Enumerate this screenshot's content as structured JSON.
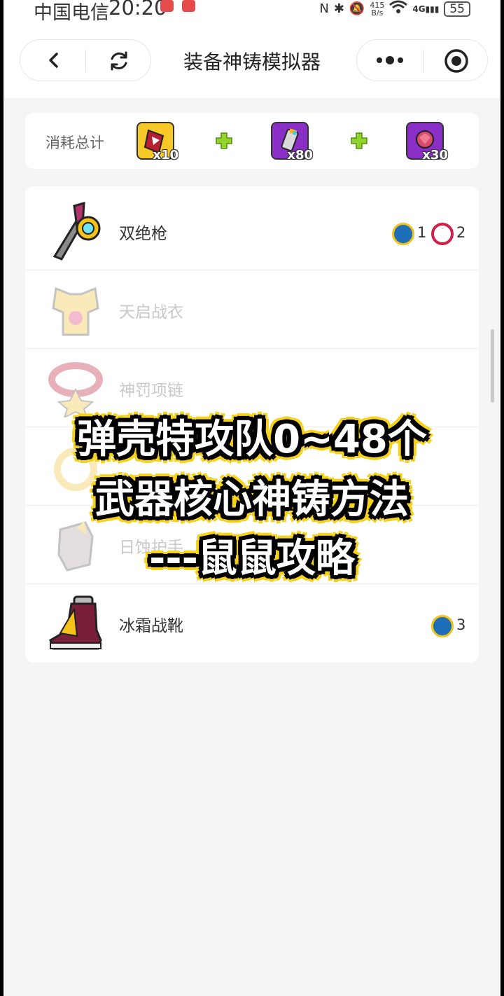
{
  "status_bar": {
    "carrier": "中国电信",
    "time": "20:20",
    "net_speed_value": "415",
    "net_speed_unit": "B/s",
    "network": "4G",
    "battery": "55"
  },
  "nav": {
    "title": "装备神铸模拟器"
  },
  "summary": {
    "label": "消耗总计",
    "resources": [
      {
        "icon": "core-red-icon",
        "count": "x10"
      },
      {
        "icon": "canister-icon",
        "count": "x80"
      },
      {
        "icon": "gem-purple-icon",
        "count": "x30"
      }
    ]
  },
  "equipment": [
    {
      "name": "双绝枪",
      "dim": false,
      "icon": "weapon-gun-icon",
      "chips": [
        {
          "icon": "blue-core-chip-icon",
          "count": "1"
        },
        {
          "icon": "red-core-chip-icon",
          "count": "2"
        }
      ]
    },
    {
      "name": "天启战衣",
      "dim": true,
      "icon": "armor-icon",
      "chips": []
    },
    {
      "name": "神罚项链",
      "dim": true,
      "icon": "necklace-icon",
      "chips": []
    },
    {
      "name": "",
      "dim": true,
      "icon": "ring-icon",
      "chips": []
    },
    {
      "name": "日蚀护手",
      "dim": true,
      "icon": "gauntlet-icon",
      "chips": []
    },
    {
      "name": "冰霜战靴",
      "dim": false,
      "icon": "boots-icon",
      "chips": [
        {
          "icon": "blue-core-chip-icon",
          "count": "3"
        }
      ]
    }
  ],
  "overlay": {
    "line1": "弹壳特攻队0~48个",
    "line2": "武器核心神铸方法",
    "line3": "---鼠鼠攻略"
  },
  "colors": {
    "accent_yellow": "#f6d21a",
    "plus_green": "#8fd42a",
    "chip_blue": "#1f6fb8",
    "chip_red": "#d0204a",
    "resource_purple": "#8a2fc6"
  }
}
